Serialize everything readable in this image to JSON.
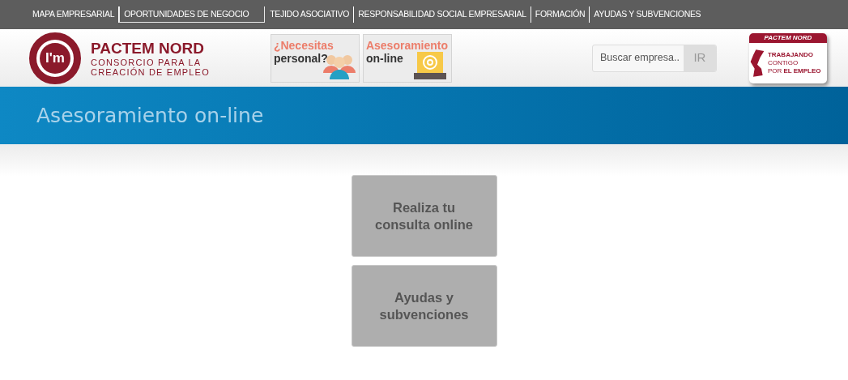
{
  "nav": [
    {
      "label": "MAPA EMPRESARIAL",
      "selected": false
    },
    {
      "label": "OPORTUNIDADES DE NEGOCIO",
      "selected": true
    },
    {
      "label": "TEJIDO ASOCIATIVO",
      "selected": false
    },
    {
      "label": "RESPONSABILIDAD SOCIAL EMPRESARIAL",
      "selected": false
    },
    {
      "label": "FORMACIÓN",
      "selected": false
    },
    {
      "label": "AYUDAS Y SUBVENCIONES",
      "selected": false
    }
  ],
  "logo": {
    "mark": "I'm",
    "name": "PACTEM NORD",
    "tagline_1": "CONSORCIO PARA LA",
    "tagline_2": "CREACIÓN DE EMPLEO"
  },
  "promos": [
    {
      "kind": "people",
      "title": "¿Necesitas",
      "subtitle": "personal?"
    },
    {
      "kind": "laptop",
      "title": "Asesoramiento",
      "subtitle": "on-line"
    }
  ],
  "search": {
    "placeholder": "Buscar empresa..",
    "button": "IR"
  },
  "badge": {
    "title": "PACTEM NORD",
    "line_1": "TRABAJANDO",
    "line_2": "CONTIGO",
    "line_3_prefix": "POR",
    "line_3": "EL EMPLEO"
  },
  "page_title": "Asesoramiento on-line",
  "tiles": [
    "Realiza tu consulta online",
    "Ayudas y subvenciones"
  ]
}
